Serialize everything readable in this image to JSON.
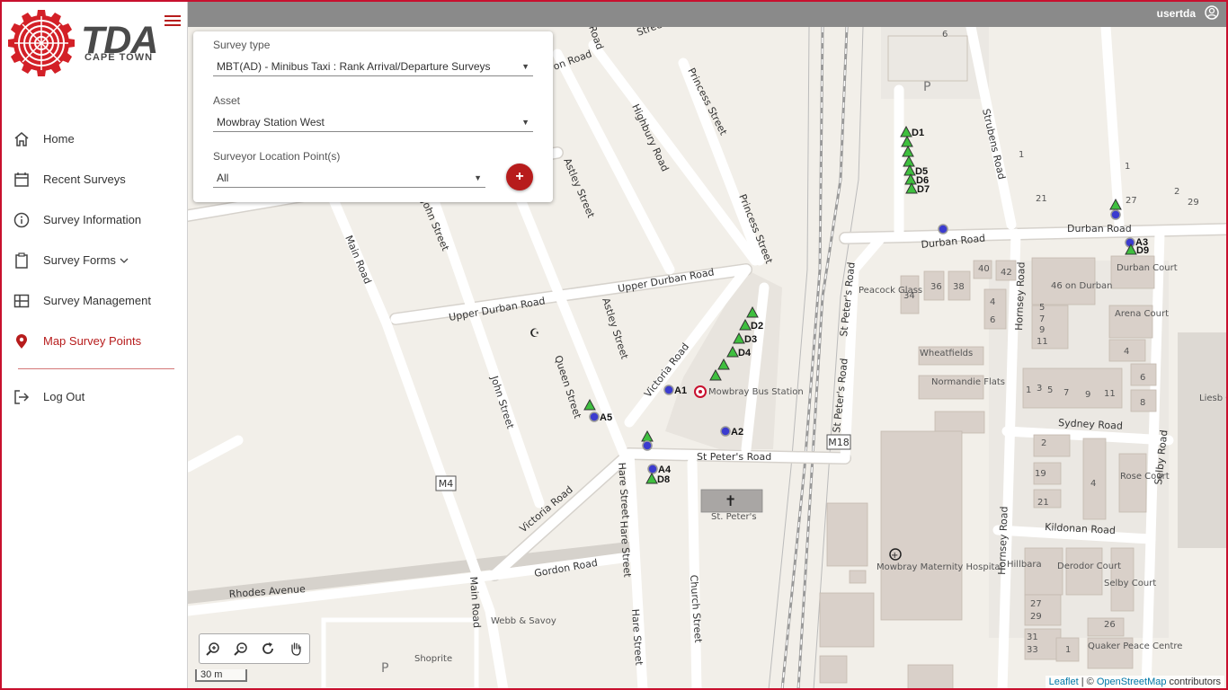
{
  "app": {
    "logo_text": "TDA",
    "logo_subtext": "CAPE TOWN",
    "username": "usertda"
  },
  "sidebar": {
    "items": [
      {
        "label": "Home",
        "icon": "home-icon"
      },
      {
        "label": "Recent Surveys",
        "icon": "calendar-icon"
      },
      {
        "label": "Survey Information",
        "icon": "info-icon"
      },
      {
        "label": "Survey Forms",
        "icon": "clipboard-icon"
      },
      {
        "label": "Survey Management",
        "icon": "table-icon"
      },
      {
        "label": "Map Survey Points",
        "icon": "map-pin-icon",
        "active": true
      }
    ],
    "logout_label": "Log Out"
  },
  "filters": {
    "survey_type_label": "Survey type",
    "survey_type_value": "MBT(AD) - Minibus Taxi : Rank Arrival/Departure Surveys",
    "asset_label": "Asset",
    "asset_value": "Mowbray Station West",
    "location_label": "Surveyor Location Point(s)",
    "location_value": "All",
    "add_button": "+"
  },
  "map": {
    "streets": [
      "Princess Street",
      "Highbury Road",
      "Astley Street",
      "John Street",
      "Main Road",
      "Upper Durban Road",
      "Upper Durban Road",
      "Astley Street",
      "Queen Street",
      "John Street",
      "Victoria Road",
      "Victoria Road",
      "St Peter's Road",
      "Hare Street",
      "Hare Street",
      "Hare Street",
      "Church Street",
      "Gordon Road",
      "Rhodes Avenue",
      "Main Road",
      "Durban Road",
      "Durban Road",
      "Strubens Road",
      "St Peter's Road",
      "St Peter's Road",
      "Hornsey Road",
      "Hornsey Road",
      "Sydney Road",
      "Selby Road",
      "Kildonan Road",
      "Princess Street",
      "Street",
      "Road",
      "on Road"
    ],
    "places": [
      "Mowbray Bus Station",
      "St. Peter's",
      "Webb & Savoy",
      "Shoprite",
      "Mowbray Maternity Hospital",
      "Wheatfields",
      "Normandie Flats",
      "46 on Durban",
      "Durban Court",
      "Arena Court",
      "Rose Court",
      "Hillbara",
      "Derodor Court",
      "Selby Court",
      "Quaker Peace Centre",
      "Peacock Glass",
      "Liesb Gard"
    ],
    "route_shields": [
      "M4",
      "M18"
    ],
    "points": [
      {
        "label": "A1",
        "kind": "circle"
      },
      {
        "label": "A2",
        "kind": "circle"
      },
      {
        "label": "A3",
        "kind": "circle"
      },
      {
        "label": "A4",
        "kind": "circle"
      },
      {
        "label": "A5",
        "kind": "circle"
      },
      {
        "label": "D1",
        "kind": "triangle"
      },
      {
        "label": "D2",
        "kind": "triangle"
      },
      {
        "label": "D3",
        "kind": "triangle"
      },
      {
        "label": "D4",
        "kind": "triangle"
      },
      {
        "label": "D5",
        "kind": "triangle"
      },
      {
        "label": "D6",
        "kind": "triangle"
      },
      {
        "label": "D7",
        "kind": "triangle"
      },
      {
        "label": "D8",
        "kind": "triangle"
      },
      {
        "label": "D9",
        "kind": "triangle"
      }
    ],
    "house_numbers": [
      "6",
      "1",
      "1",
      "2",
      "21",
      "27",
      "29",
      "40",
      "42",
      "34",
      "36",
      "38",
      "4",
      "6",
      "5",
      "7",
      "9",
      "11",
      "4",
      "6",
      "8",
      "1",
      "3",
      "5",
      "7",
      "9",
      "11",
      "2",
      "19",
      "21",
      "4",
      "27",
      "29",
      "31",
      "33",
      "1",
      "26"
    ],
    "scale_label": "30 m",
    "attribution_leaflet": "Leaflet",
    "attribution_sep": " | © ",
    "attribution_osm": "OpenStreetMap",
    "attribution_suffix": " contributors"
  },
  "colors": {
    "brand_red": "#b71c1c",
    "topbar_gray": "#8a8a8a",
    "marker_blue": "#3b3bcf",
    "marker_green": "#3fbf3f"
  }
}
